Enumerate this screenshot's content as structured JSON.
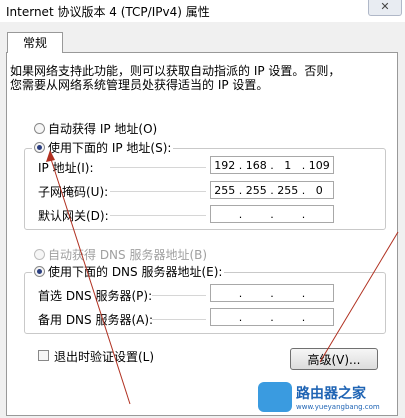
{
  "window": {
    "title": "Internet 协议版本 4 (TCP/IPv4) 属性",
    "close_glyph": "✕"
  },
  "tabs": [
    {
      "label": "常规",
      "active": true
    }
  ],
  "intro": {
    "line1": "如果网络支持此功能，则可以获取自动指派的 IP 设置。否则，",
    "line2": "您需要从网络系统管理员处获得适当的 IP 设置。"
  },
  "ip_group": {
    "auto_label": "自动获得 IP 地址(O)",
    "manual_label": "使用下面的 IP 地址(S):",
    "selected": "manual",
    "fields": [
      {
        "label": "IP 地址(I):",
        "octets": [
          "192",
          "168",
          "1",
          "109"
        ]
      },
      {
        "label": "子网掩码(U):",
        "octets": [
          "255",
          "255",
          "255",
          "0"
        ]
      },
      {
        "label": "默认网关(D):",
        "octets": [
          "",
          "",
          "",
          ""
        ]
      }
    ]
  },
  "dns_group": {
    "auto_label": "自动获得 DNS 服务器地址(B)",
    "manual_label": "使用下面的 DNS 服务器地址(E):",
    "selected": "manual",
    "fields": [
      {
        "label": "首选 DNS 服务器(P):",
        "octets": [
          "",
          "",
          "",
          ""
        ]
      },
      {
        "label": "备用 DNS 服务器(A):",
        "octets": [
          "",
          "",
          "",
          ""
        ]
      }
    ]
  },
  "validate_on_exit": {
    "label": "退出时验证设置(L)",
    "checked": false
  },
  "advanced_button": {
    "label": "高级(V)..."
  },
  "watermark": {
    "brand": "路由器之家",
    "url": "www.yueyangbang.com"
  },
  "colors": {
    "annotation_arrow": "#b03020",
    "accent": "#2a3e80"
  }
}
